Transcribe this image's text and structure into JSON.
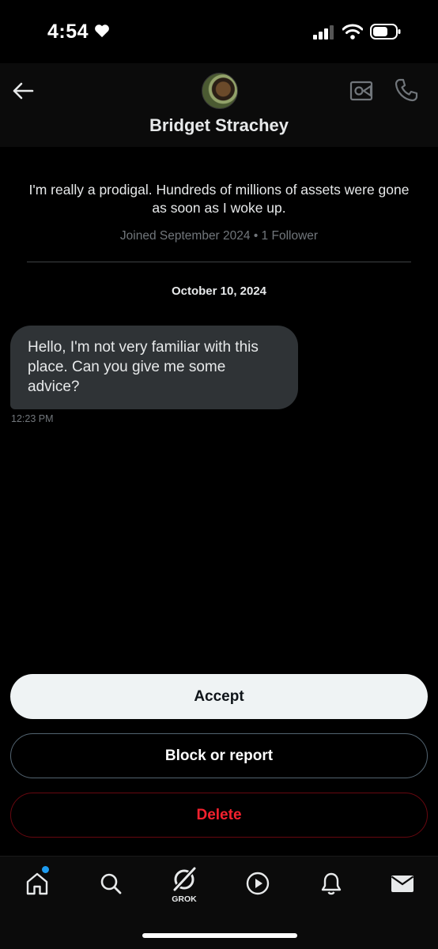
{
  "status_bar": {
    "time": "4:54"
  },
  "header": {
    "name": "Bridget Strachey"
  },
  "profile": {
    "bio": "I'm really a prodigal. Hundreds of millions of assets were gone as soon as I woke up.",
    "meta": "Joined September 2024 • 1 Follower"
  },
  "conversation": {
    "date": "October 10, 2024",
    "messages": [
      {
        "text": "Hello, I'm not very familiar with this place. Can you give me some advice?",
        "time": "12:23 PM"
      }
    ]
  },
  "actions": {
    "accept": "Accept",
    "block": "Block or report",
    "delete": "Delete"
  },
  "tabbar": {
    "grok_label": "GROK"
  }
}
